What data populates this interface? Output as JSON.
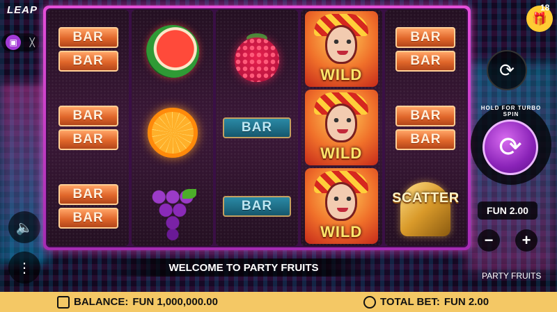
{
  "app": {
    "logo": "LEAP",
    "top_right_counter": "18"
  },
  "camera": {
    "on_icon": "video-camera-icon",
    "off_icon": "video-off-icon"
  },
  "reels": [
    {
      "cells": [
        "BAR BAR",
        "BAR BAR",
        "BAR BAR"
      ]
    },
    {
      "cells": [
        "watermelon",
        "orange",
        "grapes"
      ]
    },
    {
      "cells": [
        "raspberry",
        "BAR",
        "BAR"
      ]
    },
    {
      "cells": [
        "WILD",
        "WILD",
        "WILD"
      ]
    },
    {
      "cells": [
        "BAR BAR",
        "BAR BAR",
        "SCATTER"
      ]
    }
  ],
  "symbols": {
    "bar": "BAR",
    "wild": "WILD",
    "scatter": "SCATTER"
  },
  "controls": {
    "turbo_label": "HOLD FOR TURBO SPIN",
    "bet_value": "FUN 2.00",
    "minus": "−",
    "plus": "+"
  },
  "messages": {
    "welcome": "WELCOME TO PARTY FRUITS",
    "game_name": "PARTY FRUITS"
  },
  "status": {
    "balance_label": "BALANCE:",
    "balance_value": "FUN 1,000,000.00",
    "total_bet_label": "TOTAL BET:",
    "total_bet_value": "FUN 2.00"
  }
}
